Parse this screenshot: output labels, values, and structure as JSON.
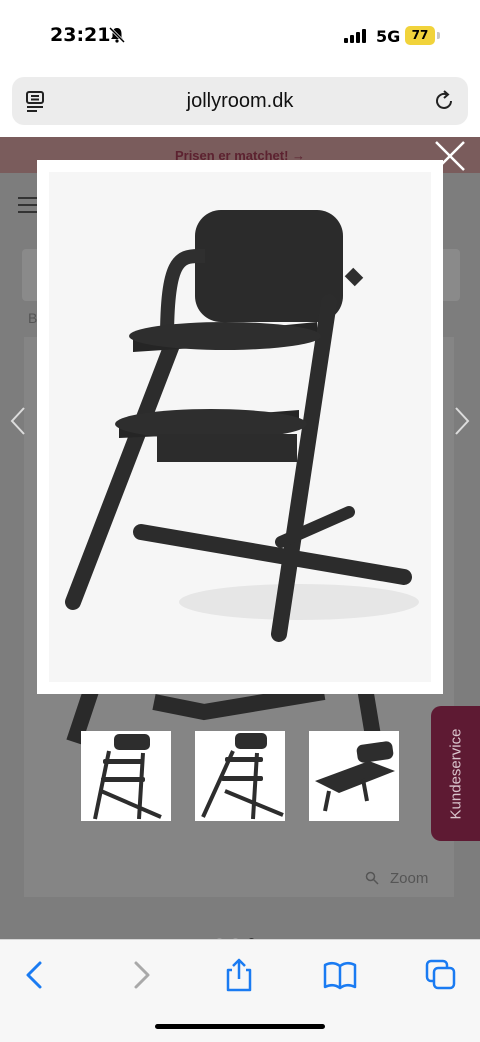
{
  "status_bar": {
    "time": "23:21",
    "network": "5G",
    "battery": "77"
  },
  "browser": {
    "url": "jollyroom.dk"
  },
  "page": {
    "promo_text": "Prisen er matchet! →",
    "breadcrumb": "B",
    "zoom_label": "Zoom",
    "customer_service_label": "Kundeservice"
  },
  "modal": {
    "image_icon": "high-chair-product-image",
    "thumbnails": [
      "high-chair-front-view",
      "high-chair-side-view",
      "bouncer-attachment-view"
    ]
  },
  "colors": {
    "accent": "#5e1a33",
    "toolbar_blue": "#1a7bf2",
    "battery": "#f1d33b"
  }
}
